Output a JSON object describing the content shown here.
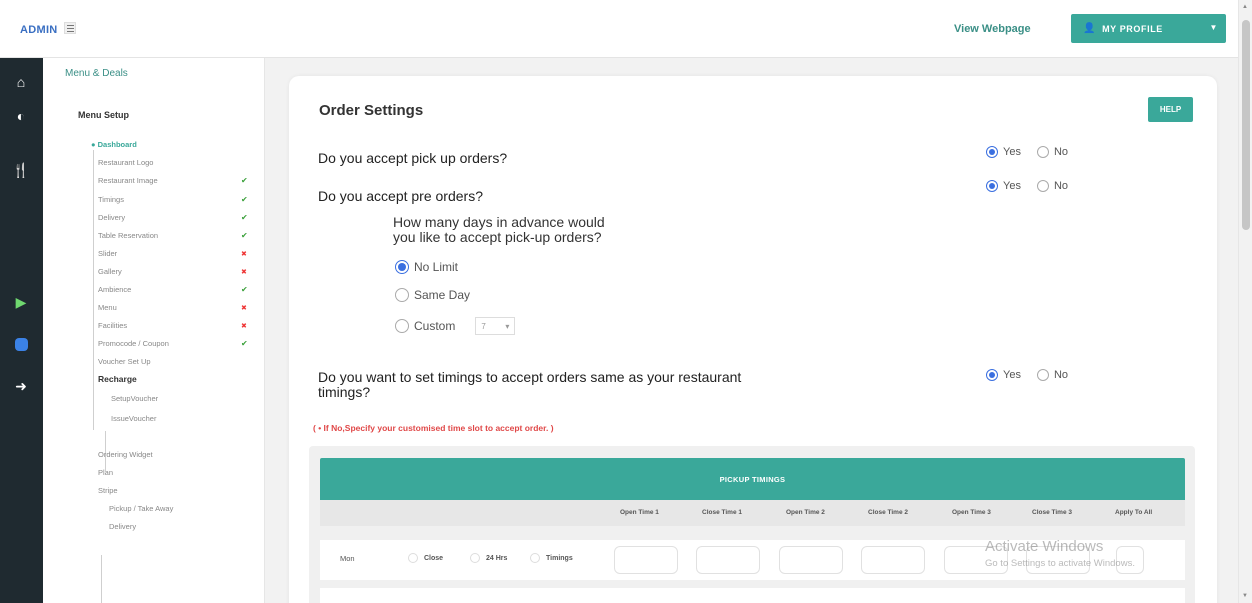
{
  "header": {
    "brand": "ADMIN",
    "view_webpage": "View Webpage",
    "profile_label": "MY PROFILE"
  },
  "rail": {
    "icons": [
      "home-icon",
      "dashboard-icon",
      "restaurant-icon",
      "play-store-icon",
      "chat-icon",
      "logout-icon"
    ]
  },
  "menu": {
    "section_title": "Menu & Deals",
    "setup_title": "Menu Setup",
    "items": [
      {
        "label": "Dashboard",
        "status": ""
      },
      {
        "label": "Restaurant Logo",
        "status": ""
      },
      {
        "label": "Restaurant Image",
        "status": "ok"
      },
      {
        "label": "Timings",
        "status": "ok"
      },
      {
        "label": "Delivery",
        "status": "ok"
      },
      {
        "label": "Table Reservation",
        "status": "ok"
      },
      {
        "label": "Slider",
        "status": "no"
      },
      {
        "label": "Gallery",
        "status": "no"
      },
      {
        "label": "Ambience",
        "status": "ok"
      },
      {
        "label": "Menu",
        "status": "no"
      },
      {
        "label": "Facilities",
        "status": "no"
      },
      {
        "label": "Promocode / Coupon",
        "status": "ok"
      },
      {
        "label": "Voucher Set Up",
        "status": ""
      },
      {
        "label": "Recharge",
        "status": ""
      },
      {
        "label": "SetupVoucher",
        "status": ""
      },
      {
        "label": "IssueVoucher",
        "status": ""
      },
      {
        "label": "Ordering Widget",
        "status": ""
      },
      {
        "label": "Plan",
        "status": ""
      },
      {
        "label": "Stripe",
        "status": ""
      },
      {
        "label": "Pickup / Take Away",
        "status": ""
      },
      {
        "label": "Delivery",
        "status": ""
      }
    ]
  },
  "main": {
    "title": "Order Settings",
    "help_label": "HELP",
    "q_pickup": "Do you accept pick up orders?",
    "q_preorder": "Do you accept pre orders?",
    "q_days_line1": "How many days in advance would",
    "q_days_line2": "you like to accept pick-up orders?",
    "opt_no_limit": "No Limit",
    "opt_same_day": "Same Day",
    "opt_custom": "Custom",
    "custom_value": "7",
    "q_timings_line1": "Do you want to set timings to accept orders same as your restaurant",
    "q_timings_line2": "timings?",
    "yes": "Yes",
    "no": "No",
    "note": "( • If No,Specify your customised time slot to accept order. )"
  },
  "table": {
    "title": "PICKUP TIMINGS",
    "columns": [
      "Open Time 1",
      "Close Time 1",
      "Open Time 2",
      "Close Time 2",
      "Open Time 3",
      "Close Time 3",
      "Apply To All"
    ],
    "rows": [
      {
        "day": "Mon",
        "close": "Close",
        "h24": "24 Hrs",
        "timings": "Timings"
      }
    ]
  },
  "watermark": {
    "line1": "Activate Windows",
    "line2": "Go to Settings to activate Windows."
  }
}
